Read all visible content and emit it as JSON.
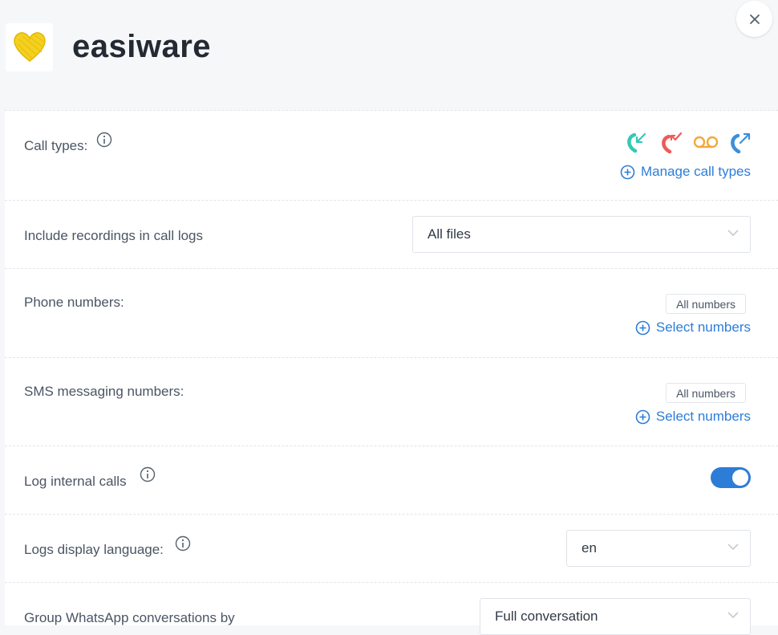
{
  "header": {
    "app_name": "easiware"
  },
  "settings": {
    "call_types": {
      "label": "Call types:",
      "icons": [
        "incoming-call-icon",
        "missed-call-icon",
        "voicemail-icon",
        "outgoing-call-icon"
      ],
      "manage_label": "Manage call types"
    },
    "recordings": {
      "label": "Include recordings in call logs",
      "value": "All files"
    },
    "phone_numbers": {
      "label": "Phone numbers:",
      "tag": "All numbers",
      "select_label": "Select numbers"
    },
    "sms_numbers": {
      "label": "SMS messaging numbers:",
      "tag": "All numbers",
      "select_label": "Select numbers"
    },
    "internal_calls": {
      "label": "Log internal calls",
      "enabled": true
    },
    "display_language": {
      "label": "Logs display language:",
      "value": "en"
    },
    "whatsapp_grouping": {
      "label": "Group WhatsApp conversations by",
      "value": "Full conversation"
    }
  },
  "colors": {
    "accent": "#2d7dd8",
    "incoming": "#33c9b5",
    "missed": "#ef5a5a",
    "voicemail": "#f2a93b",
    "outgoing": "#3b8fdc",
    "logo": "#f5d020"
  }
}
